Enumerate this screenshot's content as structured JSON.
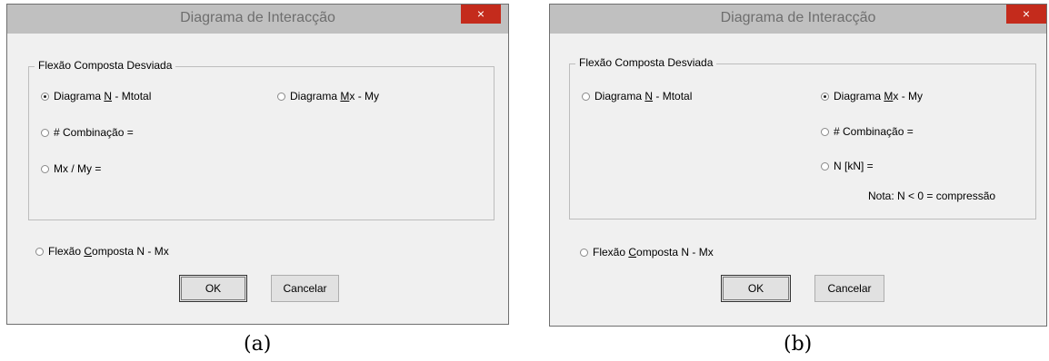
{
  "panel_a": {
    "title": "Diagrama de Interacção",
    "close_label": "×",
    "group_label": "Flexão Composta Desviada",
    "radio_n_mtotal_pre": "Diagrama ",
    "radio_n_mtotal_u": "N",
    "radio_n_mtotal_post": " - Mtotal",
    "radio_mx_my_pre": "Diagrama ",
    "radio_mx_my_u": "M",
    "radio_mx_my_post": "x - My",
    "radio_combinacao": "# Combinação =",
    "radio_mx_over_my": "Mx / My =",
    "radio_flexao_pre": "Flexão ",
    "radio_flexao_u": "C",
    "radio_flexao_post": "omposta N - Mx",
    "ok_label": "OK",
    "cancel_label": "Cancelar",
    "caption": "(a)",
    "selected": "Diagrama N - Mtotal"
  },
  "panel_b": {
    "title": "Diagrama de Interacção",
    "close_label": "×",
    "group_label": "Flexão Composta Desviada",
    "radio_n_mtotal_pre": "Diagrama ",
    "radio_n_mtotal_u": "N",
    "radio_n_mtotal_post": " - Mtotal",
    "radio_mx_my_pre": "Diagrama ",
    "radio_mx_my_u": "M",
    "radio_mx_my_post": "x - My",
    "radio_combinacao": "# Combinação =",
    "radio_n_kn": "N [kN] =",
    "note": "Nota: N < 0 = compressão",
    "radio_flexao_pre": "Flexão ",
    "radio_flexao_u": "C",
    "radio_flexao_post": "omposta N - Mx",
    "ok_label": "OK",
    "cancel_label": "Cancelar",
    "caption": "(b)",
    "selected": "Diagrama Mx - My"
  },
  "colors": {
    "titlebar": "#c0c0c0",
    "close": "#c42b1c",
    "dialog": "#f0f0f0"
  }
}
